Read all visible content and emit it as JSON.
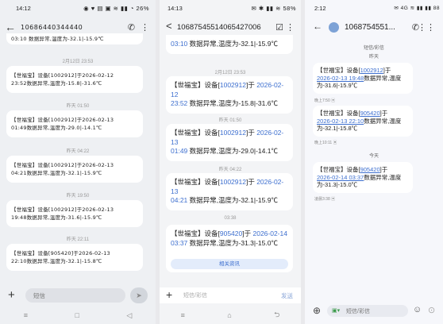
{
  "phone1": {
    "status": {
      "time": "14:12",
      "icons": "◉ ♥ ▤ ▣ ≋ ▮▮ ◔ 26%"
    },
    "header": {
      "back": "←",
      "number": "10686440344440",
      "call_icon": "✆",
      "more_icon": "⋮"
    },
    "top_partial": "03:10 数据异常,温度为-32.1|-15.9℃",
    "messages": [
      {
        "time": "2月12日 23:53",
        "text_a": "【世福宝】设备[1002912]于2026-02-12",
        "text_b": "23:52数据异常,温度为-15.8|-31.6℃"
      },
      {
        "time": "昨天 01:50",
        "text_a": "【世福宝】设备[1002912]于2026-02-13",
        "text_b": "01:49数据异常,温度为-29.0|-14.1℃"
      },
      {
        "time": "昨天 04:22",
        "text_a": "【世福宝】设备[1002912]于2026-02-13",
        "text_b": "04:21数据异常,温度为-32.1|-15.9℃"
      },
      {
        "time": "昨天 19:50",
        "text_a": "【世福宝】设备[1002912]于2026-02-13",
        "text_b": "19:48数据异常,温度为-31.6|-15.9℃"
      },
      {
        "time": "昨天 22:11",
        "text_a": "【世福宝】设备[905420]于2026-02-13",
        "text_b": "22:10数据异常,温度为-32.1|-15.8℃"
      }
    ],
    "input": {
      "placeholder": "短信",
      "plus": "+",
      "send": "➤"
    },
    "nav": {
      "menu": "≡",
      "home": "□",
      "back": "◁"
    }
  },
  "phone2": {
    "status": {
      "time": "14:13",
      "icons": "✉ ✱ ▮▮ ≋ 58%"
    },
    "header": {
      "back": "<",
      "number": "10687545514065427006",
      "check_icon": "☑",
      "more_icon": "⋮"
    },
    "top_partial": {
      "link": "03:10",
      "text": " 数据异常,温度为-32.1|-15.9℃"
    },
    "messages": [
      {
        "time": "2月12日 23:53",
        "pre": "【世福宝】设备[",
        "dev": "1002912",
        "mid": "]于 ",
        "date": "2026-02-12",
        "time2": "23:52",
        "post": " 数据异常,温度为-15.8|-31.6℃"
      },
      {
        "time": "昨天 01:50",
        "pre": "【世福宝】设备[",
        "dev": "1002912",
        "mid": "]于 ",
        "date": "2026-02-13",
        "time2": "01:49",
        "post": " 数据异常,温度为-29.0|-14.1℃"
      },
      {
        "time": "昨天 04:22",
        "pre": "【世福宝】设备[",
        "dev": "1002912",
        "mid": "]于 ",
        "date": "2026-02-13",
        "time2": "04:21",
        "post": " 数据异常,温度为-32.1|-15.9℃"
      },
      {
        "time": "03:38",
        "pre": "【世福宝】设备[",
        "dev": "905420",
        "mid": "]于 ",
        "date": "2026-02-14",
        "time2": "03:37",
        "post": " 数据异常,温度为-31.3|-15.0℃"
      }
    ],
    "related": "相关资讯",
    "input": {
      "plus": "+",
      "placeholder": "短信/彩信",
      "send": "发送"
    },
    "nav": {
      "menu": "≡",
      "home": "⌂",
      "back": "⮌"
    }
  },
  "phone3": {
    "status": {
      "time": "2:12",
      "icons": "✉ 4G ≋ ▮▮ ▮▮ 88"
    },
    "header": {
      "back": "←",
      "number": "1068754551...",
      "call_icon": "✆",
      "more_icon": "⋮⋮"
    },
    "sub_label": "短信/彩信",
    "day1": "昨天",
    "day2": "今天",
    "messages": [
      {
        "pre": "【世福宝】设备[",
        "dev": "1002912",
        "mid": "]于",
        "datetime": "2026-02-13 19:48",
        "post": "数据异常,温度为-31.6|-15.9℃",
        "meta": "晚上7:50 ▣"
      },
      {
        "pre": "【世福宝】设备[",
        "dev": "905420",
        "mid": "]于",
        "datetime": "2026-02-13 22:10",
        "post": "数据异常,温度为-32.1|-15.8℃",
        "meta": "晚上10:11 ▣"
      },
      {
        "pre": "【世福宝】设备[",
        "dev": "905420",
        "mid": "]于",
        "datetime": "2026-02-14 03:37",
        "post": "数据异常,温度为-31.3|-15.0℃",
        "meta": "凌晨3:38 ▣"
      }
    ],
    "input": {
      "add": "⊕",
      "sim": "▣▾",
      "placeholder": "短信/彩信",
      "emoji": "☺",
      "send": "⊙"
    }
  }
}
